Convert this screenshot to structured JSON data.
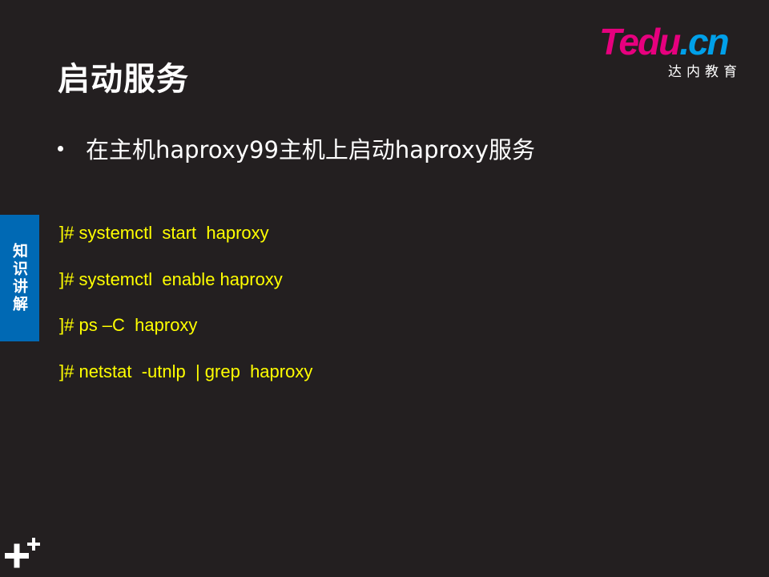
{
  "slide": {
    "title": "启动服务",
    "bullet": "在主机haproxy99主机上启动haproxy服务",
    "commands": [
      "]# systemctl  start  haproxy",
      "]# systemctl  enable haproxy",
      "]# ps –C  haproxy",
      "]# netstat  -utnlp  | grep  haproxy"
    ]
  },
  "logo": {
    "t": "T",
    "edu": "edu",
    "dot": ".",
    "cn": "cn",
    "subtitle": "达内教育"
  },
  "side_tab": {
    "label": "知识讲解"
  },
  "colors": {
    "background": "#231f20",
    "command_text": "#ffff00",
    "tab_blue": "#0069b4",
    "logo_pink": "#e6007e",
    "logo_blue": "#00a0e9"
  },
  "icons": {
    "bottom_left": "plus-icon"
  }
}
